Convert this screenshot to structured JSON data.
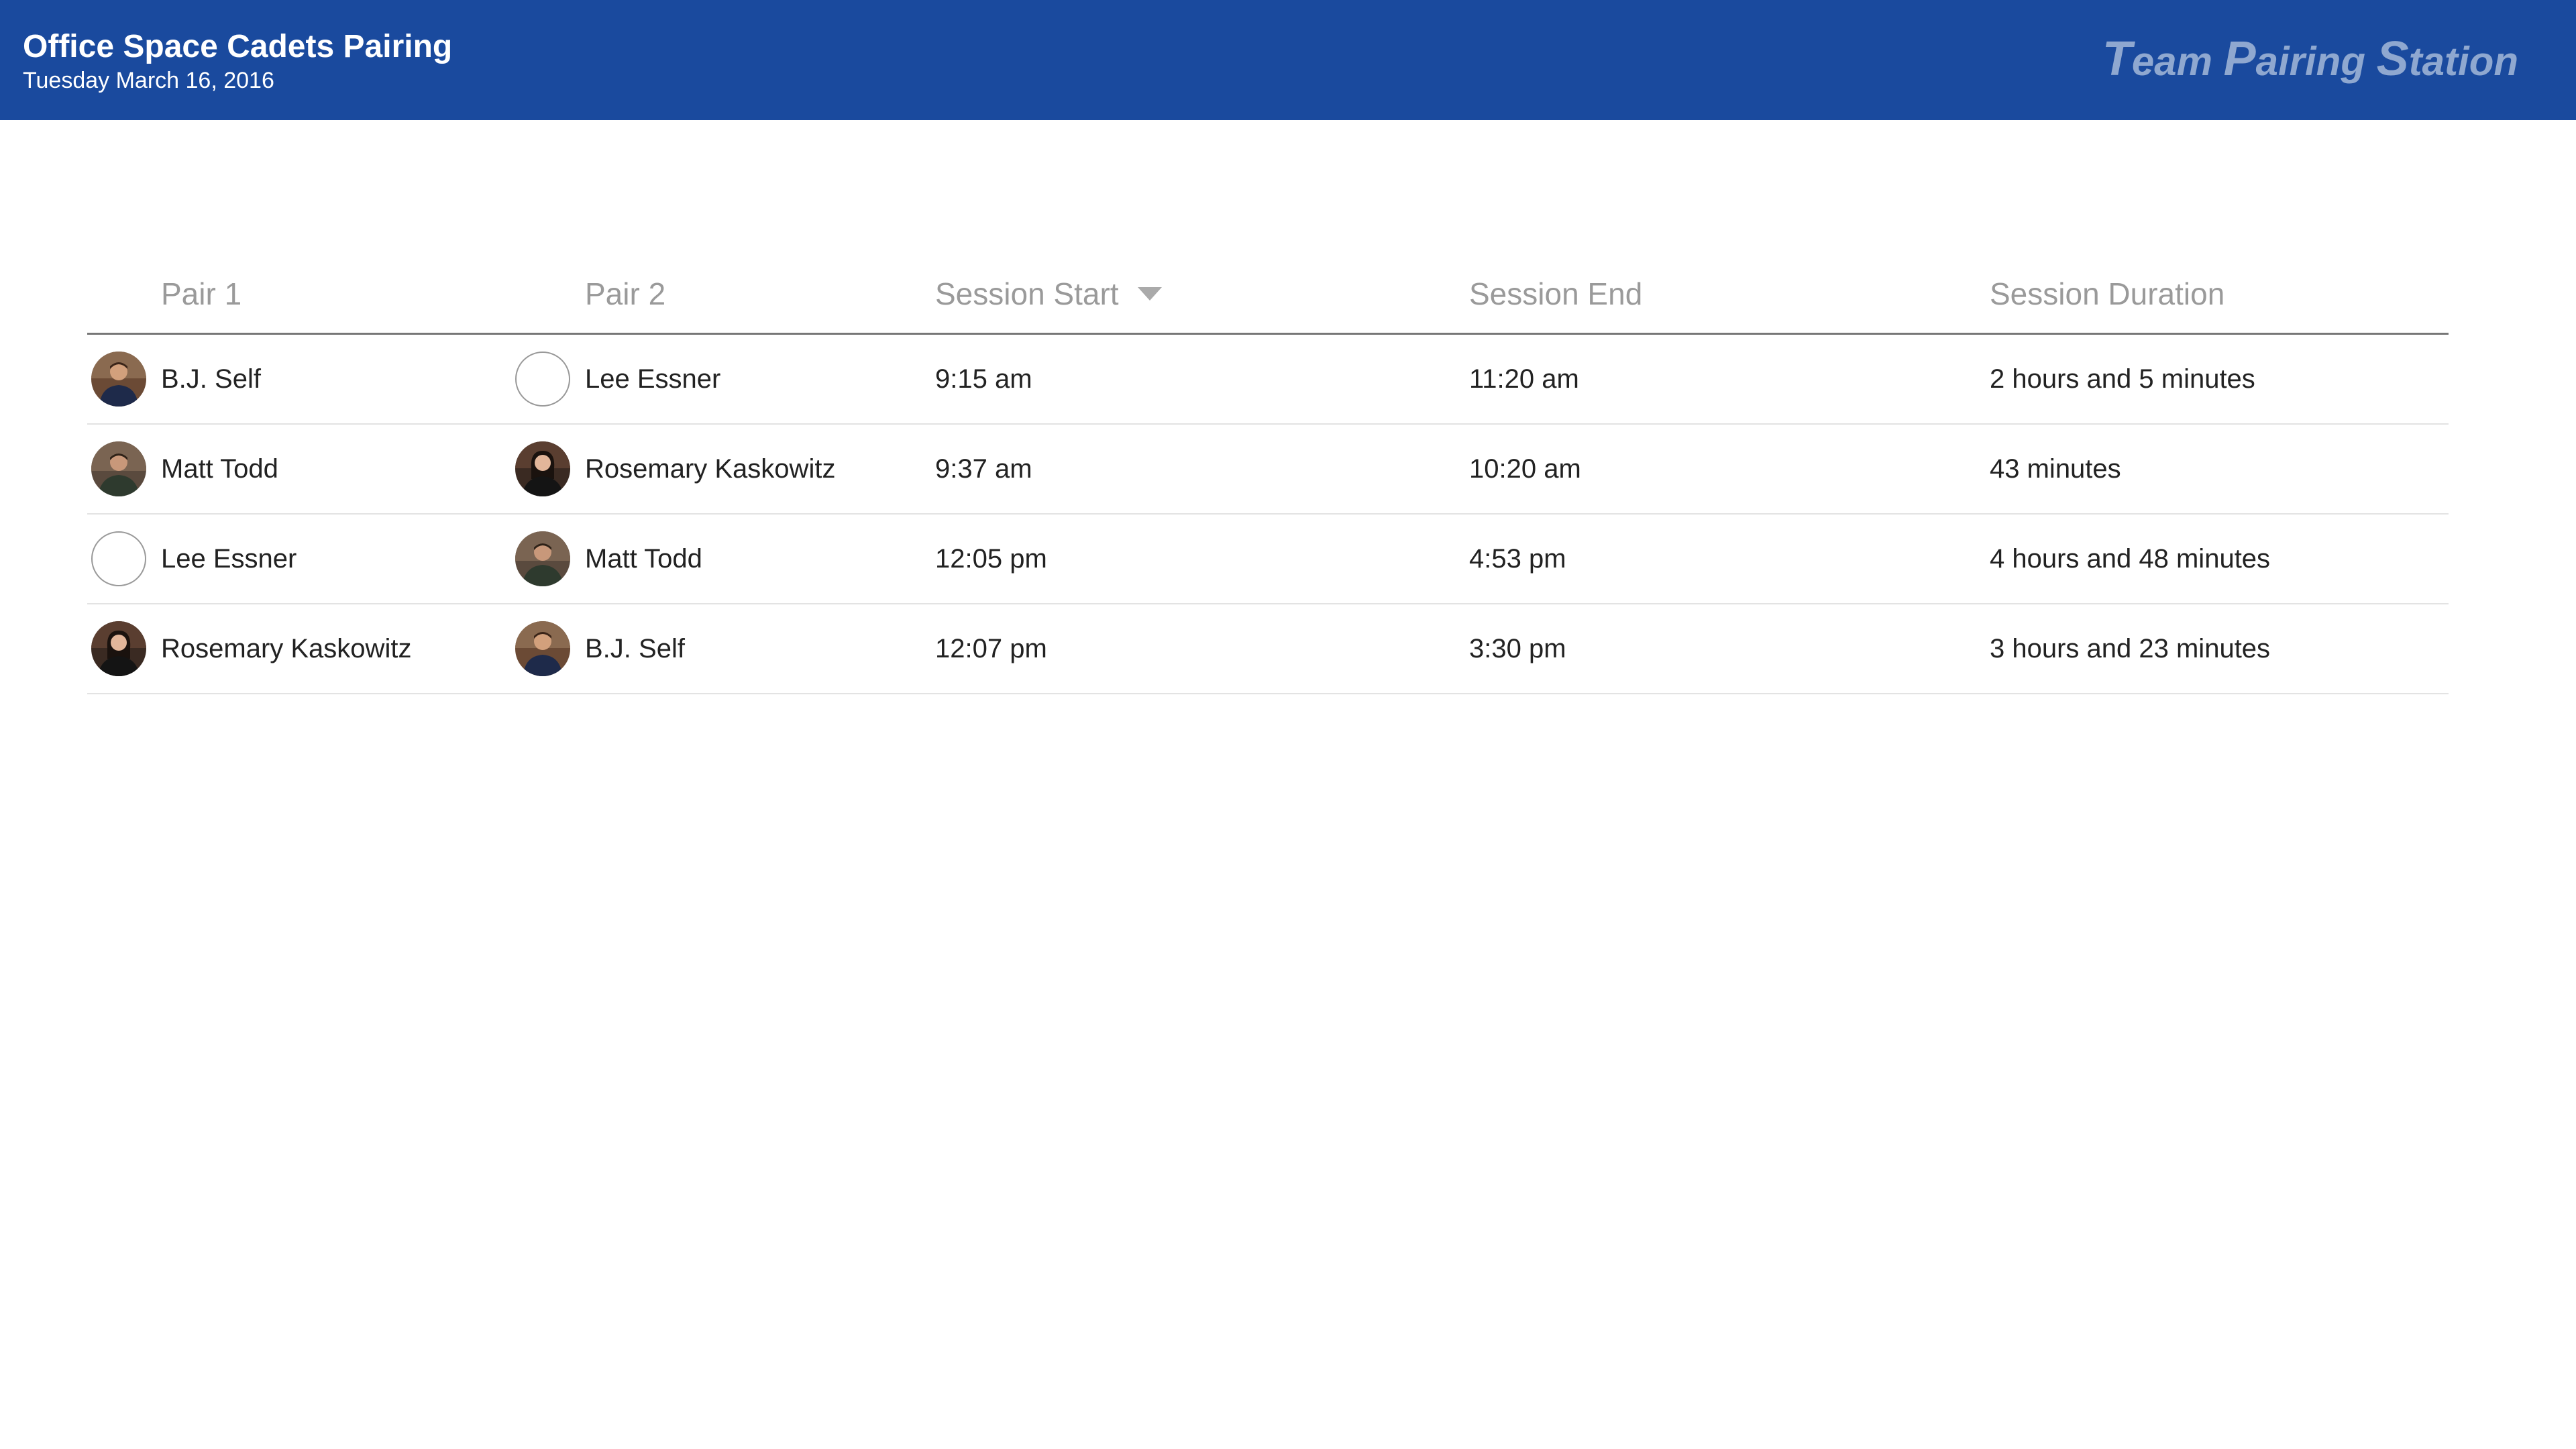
{
  "header": {
    "title": "Office Space Cadets Pairing",
    "subtitle": "Tuesday March 16, 2016",
    "brand": {
      "t_cap": "T",
      "t_rest": "eam ",
      "p_cap": "P",
      "p_rest": "airing ",
      "s_cap": "S",
      "s_rest": "tation"
    }
  },
  "table": {
    "columns": {
      "pair1": "Pair 1",
      "pair2": "Pair 2",
      "start": "Session Start",
      "end": "Session End",
      "duration": "Session Duration"
    },
    "sort_column": "Session Start",
    "rows": [
      {
        "pair1": {
          "name": "B.J. Self",
          "avatar": "photo"
        },
        "pair2": {
          "name": "Lee Essner",
          "avatar": "empty"
        },
        "start": "9:15 am",
        "end": "11:20 am",
        "duration": "2 hours and 5 minutes"
      },
      {
        "pair1": {
          "name": "Matt Todd",
          "avatar": "photo"
        },
        "pair2": {
          "name": "Rosemary Kaskowitz",
          "avatar": "photo"
        },
        "start": "9:37 am",
        "end": "10:20 am",
        "duration": "43 minutes"
      },
      {
        "pair1": {
          "name": "Lee Essner",
          "avatar": "empty"
        },
        "pair2": {
          "name": "Matt Todd",
          "avatar": "photo"
        },
        "start": "12:05 pm",
        "end": "4:53 pm",
        "duration": "4 hours and 48 minutes"
      },
      {
        "pair1": {
          "name": "Rosemary Kaskowitz",
          "avatar": "photo"
        },
        "pair2": {
          "name": "B.J. Self",
          "avatar": "photo"
        },
        "start": "12:07 pm",
        "end": "3:30 pm",
        "duration": "3 hours and 23 minutes"
      }
    ]
  },
  "colors": {
    "header_bg": "#1a4a9e",
    "brand_text": "#8fa8d0",
    "column_header_text": "#9a9a9a"
  }
}
